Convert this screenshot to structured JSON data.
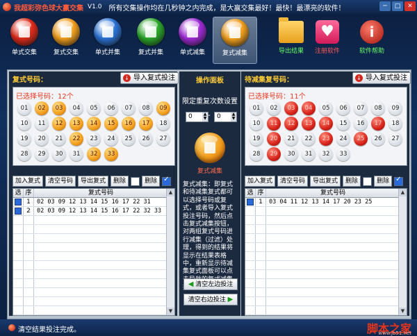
{
  "window": {
    "title": "我超彩弥色球大赢交集",
    "version": "V1.0",
    "slogan": "所有交集操作均在几秒钟之内完成，是大赢交集最好！最快！最漂亮的软件！",
    "buttons": {
      "min": "─",
      "max": "□",
      "close": "✕"
    }
  },
  "toolbar": [
    {
      "label": "单式交集",
      "icon": "red-orb-icon",
      "color": "#e02a1a"
    },
    {
      "label": "复式交集",
      "icon": "orange-orb-icon",
      "color": "#f3a01e"
    },
    {
      "label": "单式并集",
      "icon": "blue-orb-icon",
      "color": "#2a74d8"
    },
    {
      "label": "复式并集",
      "icon": "green-orb-icon",
      "color": "#2aa82a"
    },
    {
      "label": "单式减集",
      "icon": "purple-orb-icon",
      "color": "#a02ad8"
    },
    {
      "label": "复式减集",
      "icon": "orange-orb-icon",
      "color": "#f3a01e",
      "active": true
    },
    {
      "label": "导出结果",
      "icon": "folder-icon",
      "color": "#66ff66"
    },
    {
      "label": "注册软件",
      "icon": "heart-icon",
      "color": "#ff5a5a"
    },
    {
      "label": "软件帮助",
      "icon": "info-icon",
      "color": "#66ff66"
    }
  ],
  "left": {
    "title": "复式号码：",
    "import_label": "导入复式投注",
    "selected_label": "已选择号码：12个",
    "balls": [
      {
        "n": "01",
        "s": "w"
      },
      {
        "n": "02",
        "s": "o"
      },
      {
        "n": "03",
        "s": "o"
      },
      {
        "n": "04",
        "s": "w"
      },
      {
        "n": "05",
        "s": "w"
      },
      {
        "n": "06",
        "s": "w"
      },
      {
        "n": "07",
        "s": "w"
      },
      {
        "n": "08",
        "s": "w"
      },
      {
        "n": "09",
        "s": "o"
      },
      {
        "n": "10",
        "s": "w"
      },
      {
        "n": "11",
        "s": "w"
      },
      {
        "n": "12",
        "s": "o"
      },
      {
        "n": "13",
        "s": "o"
      },
      {
        "n": "14",
        "s": "o"
      },
      {
        "n": "15",
        "s": "o"
      },
      {
        "n": "16",
        "s": "o"
      },
      {
        "n": "17",
        "s": "o"
      },
      {
        "n": "18",
        "s": "w"
      },
      {
        "n": "19",
        "s": "w"
      },
      {
        "n": "20",
        "s": "w"
      },
      {
        "n": "21",
        "s": "w"
      },
      {
        "n": "22",
        "s": "o"
      },
      {
        "n": "23",
        "s": "w"
      },
      {
        "n": "24",
        "s": "w"
      },
      {
        "n": "25",
        "s": "w"
      },
      {
        "n": "26",
        "s": "w"
      },
      {
        "n": "27",
        "s": "w"
      },
      {
        "n": "28",
        "s": "w"
      },
      {
        "n": "29",
        "s": "w"
      },
      {
        "n": "30",
        "s": "w"
      },
      {
        "n": "31",
        "s": "w"
      },
      {
        "n": "32",
        "s": "o"
      },
      {
        "n": "33",
        "s": "o"
      }
    ],
    "actions": [
      "加入复式",
      "清空号码",
      "导出复式",
      "删除",
      "删除"
    ],
    "table": {
      "headers": [
        "选",
        "序",
        "复式号码"
      ],
      "rows": [
        {
          "seq": "1",
          "nums": "02 03 09 12 13 14 15 16 17 22 31"
        },
        {
          "seq": "2",
          "nums": "02 03 09 12 13 14 15 16 17 22 32 33"
        }
      ]
    }
  },
  "right": {
    "title": "待减集复号码：",
    "import_label": "导入复式投注",
    "selected_label": "已选择号码：11个",
    "balls": [
      {
        "n": "01",
        "s": "w"
      },
      {
        "n": "02",
        "s": "w"
      },
      {
        "n": "03",
        "s": "r"
      },
      {
        "n": "04",
        "s": "r"
      },
      {
        "n": "05",
        "s": "w"
      },
      {
        "n": "06",
        "s": "w"
      },
      {
        "n": "07",
        "s": "w"
      },
      {
        "n": "08",
        "s": "w"
      },
      {
        "n": "09",
        "s": "w"
      },
      {
        "n": "10",
        "s": "w"
      },
      {
        "n": "11",
        "s": "r"
      },
      {
        "n": "12",
        "s": "r"
      },
      {
        "n": "13",
        "s": "r"
      },
      {
        "n": "14",
        "s": "r"
      },
      {
        "n": "15",
        "s": "w"
      },
      {
        "n": "16",
        "s": "w"
      },
      {
        "n": "17",
        "s": "r"
      },
      {
        "n": "18",
        "s": "w"
      },
      {
        "n": "19",
        "s": "w"
      },
      {
        "n": "20",
        "s": "r"
      },
      {
        "n": "21",
        "s": "w"
      },
      {
        "n": "22",
        "s": "w"
      },
      {
        "n": "23",
        "s": "r"
      },
      {
        "n": "24",
        "s": "w"
      },
      {
        "n": "25",
        "s": "r"
      },
      {
        "n": "26",
        "s": "w"
      },
      {
        "n": "27",
        "s": "w"
      },
      {
        "n": "28",
        "s": "w"
      },
      {
        "n": "29",
        "s": "r"
      },
      {
        "n": "30",
        "s": "w"
      },
      {
        "n": "31",
        "s": "w"
      },
      {
        "n": "32",
        "s": "w"
      },
      {
        "n": "33",
        "s": "w"
      }
    ],
    "actions": [
      "加入复式",
      "清空号码",
      "导出复式",
      "删除",
      "删除"
    ],
    "table": {
      "headers": [
        "选",
        "序",
        "复式号码"
      ],
      "rows": [
        {
          "seq": "1",
          "nums": "03 04 11 12 13 14 17 20 23 25"
        }
      ]
    }
  },
  "middle": {
    "title": "操作面板",
    "limit_label": "限定重复次数设置",
    "spin_a": "0",
    "spin_b": "0",
    "dash": "-",
    "run_label": "复式减集",
    "description": "复式减集：即复式和待减集复式都可以选择号码或复式，或者导入复式投注号码，然后点击复式减集按钮，对两组复式号码进行减集（过滤）处理，得到的结果将显示在结果表格中，重新显示待减集复式面板可以点击导航的复式减集按钮",
    "clear_left": "清空左边投注",
    "clear_right": "清空右边投注"
  },
  "status": {
    "text": "清空结果投注完成。",
    "watermark": "脚本之家",
    "watermark_url": "www.jb51.net"
  }
}
